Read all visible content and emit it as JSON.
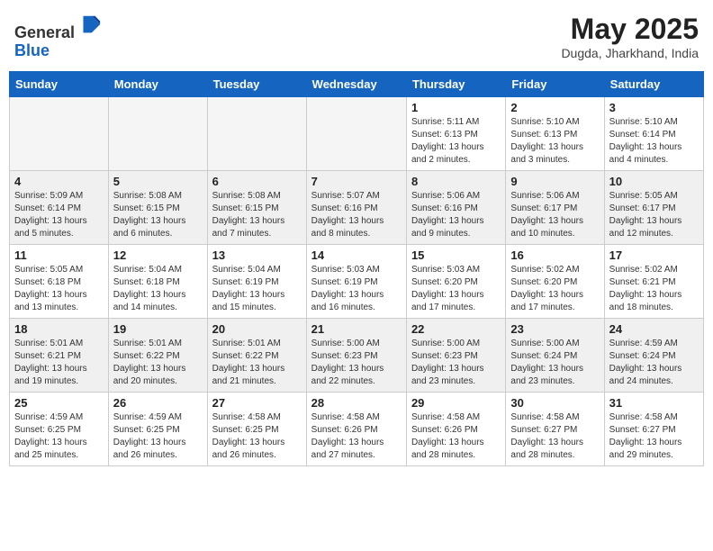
{
  "header": {
    "logo_line1": "General",
    "logo_line2": "Blue",
    "month_year": "May 2025",
    "location": "Dugda, Jharkhand, India"
  },
  "weekdays": [
    "Sunday",
    "Monday",
    "Tuesday",
    "Wednesday",
    "Thursday",
    "Friday",
    "Saturday"
  ],
  "weeks": [
    [
      {
        "day": "",
        "info": ""
      },
      {
        "day": "",
        "info": ""
      },
      {
        "day": "",
        "info": ""
      },
      {
        "day": "",
        "info": ""
      },
      {
        "day": "1",
        "info": "Sunrise: 5:11 AM\nSunset: 6:13 PM\nDaylight: 13 hours\nand 2 minutes."
      },
      {
        "day": "2",
        "info": "Sunrise: 5:10 AM\nSunset: 6:13 PM\nDaylight: 13 hours\nand 3 minutes."
      },
      {
        "day": "3",
        "info": "Sunrise: 5:10 AM\nSunset: 6:14 PM\nDaylight: 13 hours\nand 4 minutes."
      }
    ],
    [
      {
        "day": "4",
        "info": "Sunrise: 5:09 AM\nSunset: 6:14 PM\nDaylight: 13 hours\nand 5 minutes."
      },
      {
        "day": "5",
        "info": "Sunrise: 5:08 AM\nSunset: 6:15 PM\nDaylight: 13 hours\nand 6 minutes."
      },
      {
        "day": "6",
        "info": "Sunrise: 5:08 AM\nSunset: 6:15 PM\nDaylight: 13 hours\nand 7 minutes."
      },
      {
        "day": "7",
        "info": "Sunrise: 5:07 AM\nSunset: 6:16 PM\nDaylight: 13 hours\nand 8 minutes."
      },
      {
        "day": "8",
        "info": "Sunrise: 5:06 AM\nSunset: 6:16 PM\nDaylight: 13 hours\nand 9 minutes."
      },
      {
        "day": "9",
        "info": "Sunrise: 5:06 AM\nSunset: 6:17 PM\nDaylight: 13 hours\nand 10 minutes."
      },
      {
        "day": "10",
        "info": "Sunrise: 5:05 AM\nSunset: 6:17 PM\nDaylight: 13 hours\nand 12 minutes."
      }
    ],
    [
      {
        "day": "11",
        "info": "Sunrise: 5:05 AM\nSunset: 6:18 PM\nDaylight: 13 hours\nand 13 minutes."
      },
      {
        "day": "12",
        "info": "Sunrise: 5:04 AM\nSunset: 6:18 PM\nDaylight: 13 hours\nand 14 minutes."
      },
      {
        "day": "13",
        "info": "Sunrise: 5:04 AM\nSunset: 6:19 PM\nDaylight: 13 hours\nand 15 minutes."
      },
      {
        "day": "14",
        "info": "Sunrise: 5:03 AM\nSunset: 6:19 PM\nDaylight: 13 hours\nand 16 minutes."
      },
      {
        "day": "15",
        "info": "Sunrise: 5:03 AM\nSunset: 6:20 PM\nDaylight: 13 hours\nand 17 minutes."
      },
      {
        "day": "16",
        "info": "Sunrise: 5:02 AM\nSunset: 6:20 PM\nDaylight: 13 hours\nand 17 minutes."
      },
      {
        "day": "17",
        "info": "Sunrise: 5:02 AM\nSunset: 6:21 PM\nDaylight: 13 hours\nand 18 minutes."
      }
    ],
    [
      {
        "day": "18",
        "info": "Sunrise: 5:01 AM\nSunset: 6:21 PM\nDaylight: 13 hours\nand 19 minutes."
      },
      {
        "day": "19",
        "info": "Sunrise: 5:01 AM\nSunset: 6:22 PM\nDaylight: 13 hours\nand 20 minutes."
      },
      {
        "day": "20",
        "info": "Sunrise: 5:01 AM\nSunset: 6:22 PM\nDaylight: 13 hours\nand 21 minutes."
      },
      {
        "day": "21",
        "info": "Sunrise: 5:00 AM\nSunset: 6:23 PM\nDaylight: 13 hours\nand 22 minutes."
      },
      {
        "day": "22",
        "info": "Sunrise: 5:00 AM\nSunset: 6:23 PM\nDaylight: 13 hours\nand 23 minutes."
      },
      {
        "day": "23",
        "info": "Sunrise: 5:00 AM\nSunset: 6:24 PM\nDaylight: 13 hours\nand 23 minutes."
      },
      {
        "day": "24",
        "info": "Sunrise: 4:59 AM\nSunset: 6:24 PM\nDaylight: 13 hours\nand 24 minutes."
      }
    ],
    [
      {
        "day": "25",
        "info": "Sunrise: 4:59 AM\nSunset: 6:25 PM\nDaylight: 13 hours\nand 25 minutes."
      },
      {
        "day": "26",
        "info": "Sunrise: 4:59 AM\nSunset: 6:25 PM\nDaylight: 13 hours\nand 26 minutes."
      },
      {
        "day": "27",
        "info": "Sunrise: 4:58 AM\nSunset: 6:25 PM\nDaylight: 13 hours\nand 26 minutes."
      },
      {
        "day": "28",
        "info": "Sunrise: 4:58 AM\nSunset: 6:26 PM\nDaylight: 13 hours\nand 27 minutes."
      },
      {
        "day": "29",
        "info": "Sunrise: 4:58 AM\nSunset: 6:26 PM\nDaylight: 13 hours\nand 28 minutes."
      },
      {
        "day": "30",
        "info": "Sunrise: 4:58 AM\nSunset: 6:27 PM\nDaylight: 13 hours\nand 28 minutes."
      },
      {
        "day": "31",
        "info": "Sunrise: 4:58 AM\nSunset: 6:27 PM\nDaylight: 13 hours\nand 29 minutes."
      }
    ]
  ]
}
